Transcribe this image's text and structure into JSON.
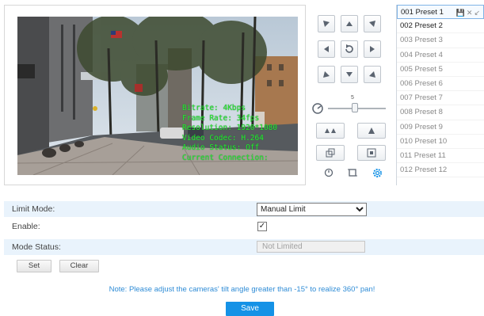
{
  "video": {
    "osd": [
      "Bitrate: 4Kbps",
      "Frame Rate: 34fps",
      "Resolution: 1920*1080",
      "Video Codec: H.264",
      "Audio Status: Off",
      "Current Connection:"
    ]
  },
  "ptz": {
    "zoom_value": "5",
    "icons": {
      "up_left": "arrow-up-left-icon",
      "up": "arrow-up-icon",
      "up_right": "arrow-up-right-icon",
      "left": "arrow-left-icon",
      "auto": "rotate-icon",
      "right": "arrow-right-icon",
      "down_left": "arrow-down-left-icon",
      "down": "arrow-down-icon",
      "down_right": "arrow-down-right-icon",
      "speed": "speed-icon",
      "focus_out": "zoom-out-icon",
      "focus_in": "zoom-in-icon",
      "iris_out": "iris-out-icon",
      "iris_in": "iris-in-icon",
      "timer": "timer-icon",
      "crop": "crop-icon",
      "settings": "gear-icon"
    }
  },
  "presets": [
    {
      "label": "001 Preset 1"
    },
    {
      "label": "002 Preset 2"
    },
    {
      "label": "003 Preset 3"
    },
    {
      "label": "004 Preset 4"
    },
    {
      "label": "005 Preset 5"
    },
    {
      "label": "006 Preset 6"
    },
    {
      "label": "007 Preset 7"
    },
    {
      "label": "008 Preset 8"
    },
    {
      "label": "009 Preset 9"
    },
    {
      "label": "010 Preset 10"
    },
    {
      "label": "011 Preset 11"
    },
    {
      "label": "012 Preset 12"
    }
  ],
  "preset_tools": {
    "save": "💾",
    "delete": "✕",
    "call": "↙"
  },
  "settings": {
    "limit_mode_label": "Limit Mode:",
    "limit_mode_value": "Manual Limit",
    "enable_label": "Enable:",
    "enable_checked": "✓",
    "mode_status_label": "Mode Status:",
    "mode_status_value": "Not Limited",
    "set_label": "Set",
    "clear_label": "Clear"
  },
  "note": "Note: Please adjust the cameras' tilt angle greater than -15° to realize 360° pan!",
  "save_label": "Save",
  "colors": {
    "accent": "#1592e6",
    "note": "#2f8cd6",
    "row_shade": "#e9f3fc",
    "osd": "#2ee82e"
  }
}
